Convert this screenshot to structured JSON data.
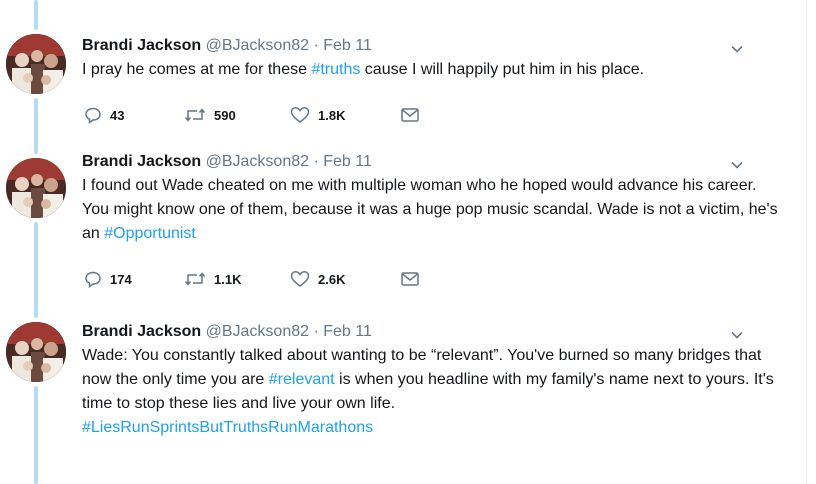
{
  "tweets": [
    {
      "name": "Brandi Jackson",
      "handle": "@BJackson82",
      "dot": "·",
      "date": "Feb 11",
      "segments": [
        {
          "text": "I pray he comes at me for these "
        },
        {
          "text": "#truths",
          "hashtag": true
        },
        {
          "text": " cause I will happily put him in his place."
        }
      ],
      "reply_count": "43",
      "retweet_count": "590",
      "like_count": "1.8K"
    },
    {
      "name": "Brandi Jackson",
      "handle": "@BJackson82",
      "dot": "·",
      "date": "Feb 11",
      "segments": [
        {
          "text": "I found out Wade cheated on me with multiple woman who he hoped would advance his career.  You might know one of them, because it was a huge pop music scandal.  Wade is not a victim, he's an "
        },
        {
          "text": "#Opportunist",
          "hashtag": true
        }
      ],
      "reply_count": "174",
      "retweet_count": "1.1K",
      "like_count": "2.6K"
    },
    {
      "name": "Brandi Jackson",
      "handle": "@BJackson82",
      "dot": "·",
      "date": "Feb 11",
      "segments": [
        {
          "text": "Wade: You constantly talked about wanting to be “relevant”. You've burned so many bridges that now the only time you are "
        },
        {
          "text": "#relevant",
          "hashtag": true
        },
        {
          "text": " is when you headline with my family's name next to yours. It's time to stop these lies and live your own life."
        },
        {
          "text": "\n"
        },
        {
          "text": "#LiesRunSprintsButTruthsRunMarathons",
          "hashtag": true
        }
      ]
    }
  ],
  "colors": {
    "hashtag": "#1da1f2",
    "icon": "#657786",
    "thread_line": "#b7dcf2"
  },
  "icons": {
    "reply": "reply-icon",
    "retweet": "retweet-icon",
    "like": "heart-icon",
    "dm": "envelope-icon",
    "menu": "chevron-down-icon"
  }
}
